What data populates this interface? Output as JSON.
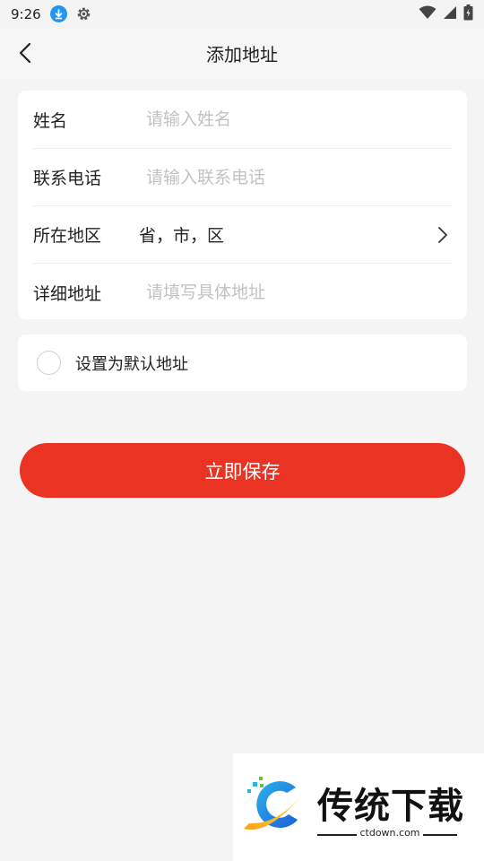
{
  "status_bar": {
    "time": "9:26"
  },
  "nav": {
    "title": "添加地址"
  },
  "form": {
    "name_label": "姓名",
    "name_placeholder": "请输入姓名",
    "phone_label": "联系电话",
    "phone_placeholder": "请输入联系电话",
    "region_label": "所在地区",
    "region_value": "省，市，区",
    "detail_label": "详细地址",
    "detail_placeholder": "请填写具体地址"
  },
  "default_address": {
    "label": "设置为默认地址",
    "checked": false
  },
  "save_button": {
    "label": "立即保存"
  },
  "watermark": {
    "brand": "传统下载",
    "site": "ctdown.com"
  },
  "colors": {
    "accent": "#eb3324",
    "background": "#f4f4f4",
    "card": "#ffffff",
    "placeholder": "#c2c2c2"
  }
}
